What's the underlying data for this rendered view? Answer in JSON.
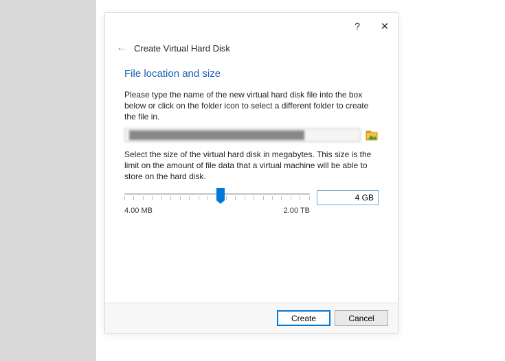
{
  "dialog": {
    "help_label": "?",
    "close_label": "✕",
    "back_label": "←",
    "wizard_title": "Create Virtual Hard Disk",
    "section_heading": "File location and size",
    "location_desc": "Please type the name of the new virtual hard disk file into the box below or click on the folder icon to select a different folder to create the file in.",
    "path_value": "██████████████████████████████",
    "size_desc": "Select the size of the virtual hard disk in megabytes. This size is the limit on the amount of file data that a virtual machine will be able to store on the hard disk.",
    "size_value": "4 GB",
    "range_min": "4.00 MB",
    "range_max": "2.00 TB",
    "create_label": "Create",
    "cancel_label": "Cancel"
  }
}
